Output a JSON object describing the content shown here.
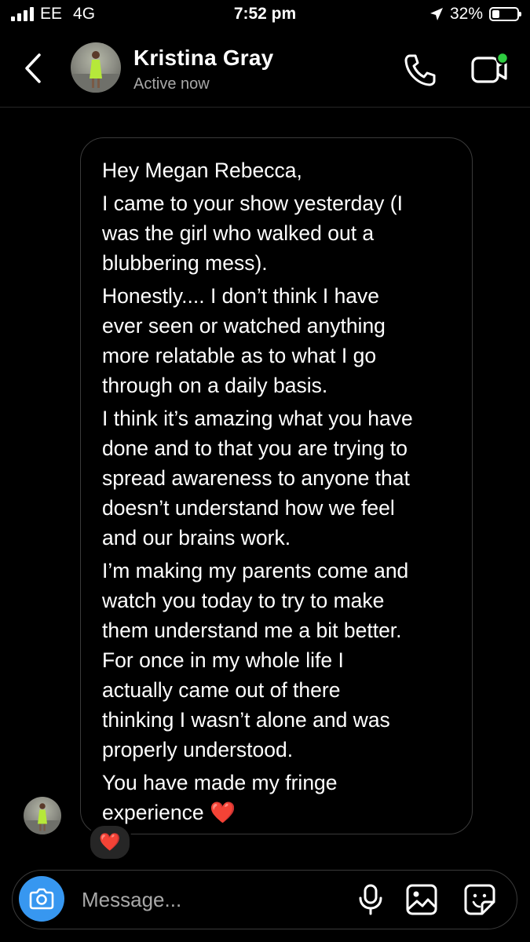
{
  "status_bar": {
    "carrier": "EE",
    "network": "4G",
    "time": "7:52 pm",
    "battery": "32%"
  },
  "header": {
    "name": "Kristina Gray",
    "status": "Active now"
  },
  "message": {
    "paragraphs": [
      "Hey Megan Rebecca,",
      "I came to your show yesterday (I\nwas the girl who walked out a\nblubbering mess).",
      "Honestly.... I don’t think I have\never seen or watched anything\nmore relatable as to what I go\nthrough on a daily basis.",
      "I think it’s amazing what you have\ndone and to that you are trying to\nspread awareness to anyone that\ndoesn’t understand how we feel\nand our brains work.",
      "I’m making my parents come and\nwatch you today to try to make\nthem understand me a bit better.\nFor once in my whole life I\nactually came out of there\nthinking I wasn’t alone and was\nproperly understood.",
      "You have made my fringe\nexperience ❤️"
    ],
    "reaction": "❤️"
  },
  "composer": {
    "placeholder": "Message..."
  },
  "icons": [
    "signal-icon",
    "location-arrow-icon",
    "battery-icon",
    "back-chevron-icon",
    "phone-icon",
    "video-call-icon",
    "camera-icon",
    "microphone-icon",
    "gallery-icon",
    "sticker-icon"
  ],
  "colors": {
    "background": "#000000",
    "accent": "#3797f0",
    "online": "#2ecc40",
    "secondary_text": "#a8a8a8"
  }
}
